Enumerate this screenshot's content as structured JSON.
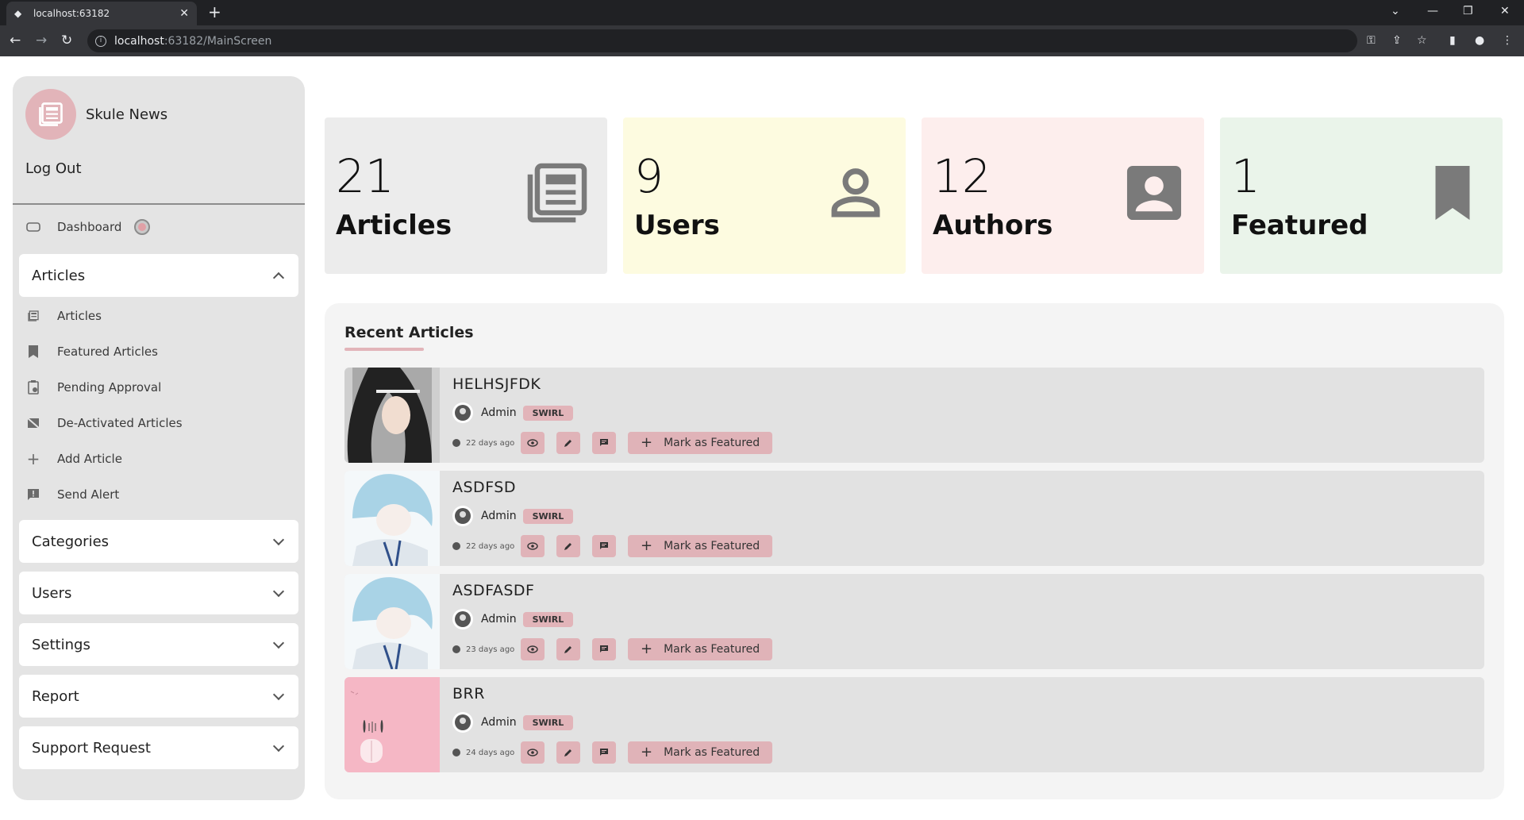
{
  "browser": {
    "tab_title": "localhost:63182",
    "url_host": "localhost",
    "url_path": ":63182/MainScreen"
  },
  "sidebar": {
    "brand": "Skule News",
    "logout": "Log Out",
    "dashboard": "Dashboard",
    "articles_group": {
      "label": "Articles",
      "items": [
        {
          "label": "Articles",
          "icon": "newspaper-icon"
        },
        {
          "label": "Featured Articles",
          "icon": "bookmark-icon"
        },
        {
          "label": "Pending Approval",
          "icon": "clipboard-clock-icon"
        },
        {
          "label": "De-Activated Articles",
          "icon": "newspaper-off-icon"
        },
        {
          "label": "Add Article",
          "icon": "plus-icon"
        },
        {
          "label": "Send Alert",
          "icon": "alert-message-icon"
        }
      ]
    },
    "collapsed_groups": [
      "Categories",
      "Users",
      "Settings",
      "Report",
      "Support Request"
    ]
  },
  "stats": [
    {
      "value": "21",
      "label": "Articles",
      "color": "#ececec",
      "icon": "newspaper-icon"
    },
    {
      "value": "9",
      "label": "Users",
      "color": "#fdfbe0",
      "icon": "person-icon"
    },
    {
      "value": "12",
      "label": "Authors",
      "color": "#fdeeed",
      "icon": "account-box-icon"
    },
    {
      "value": "1",
      "label": "Featured",
      "color": "#eaf4ea",
      "icon": "bookmark-icon"
    }
  ],
  "recent": {
    "title": "Recent Articles",
    "mark_featured_label": "Mark as Featured",
    "articles": [
      {
        "title": "HELHSJFDK",
        "author": "Admin",
        "category": "SWIRL",
        "time": "22 days ago"
      },
      {
        "title": "ASDFSD",
        "author": "Admin",
        "category": "SWIRL",
        "time": "22 days ago"
      },
      {
        "title": "ASDFASDF",
        "author": "Admin",
        "category": "SWIRL",
        "time": "23 days ago"
      },
      {
        "title": "BRR",
        "author": "Admin",
        "category": "SWIRL",
        "time": "24 days ago"
      }
    ]
  }
}
